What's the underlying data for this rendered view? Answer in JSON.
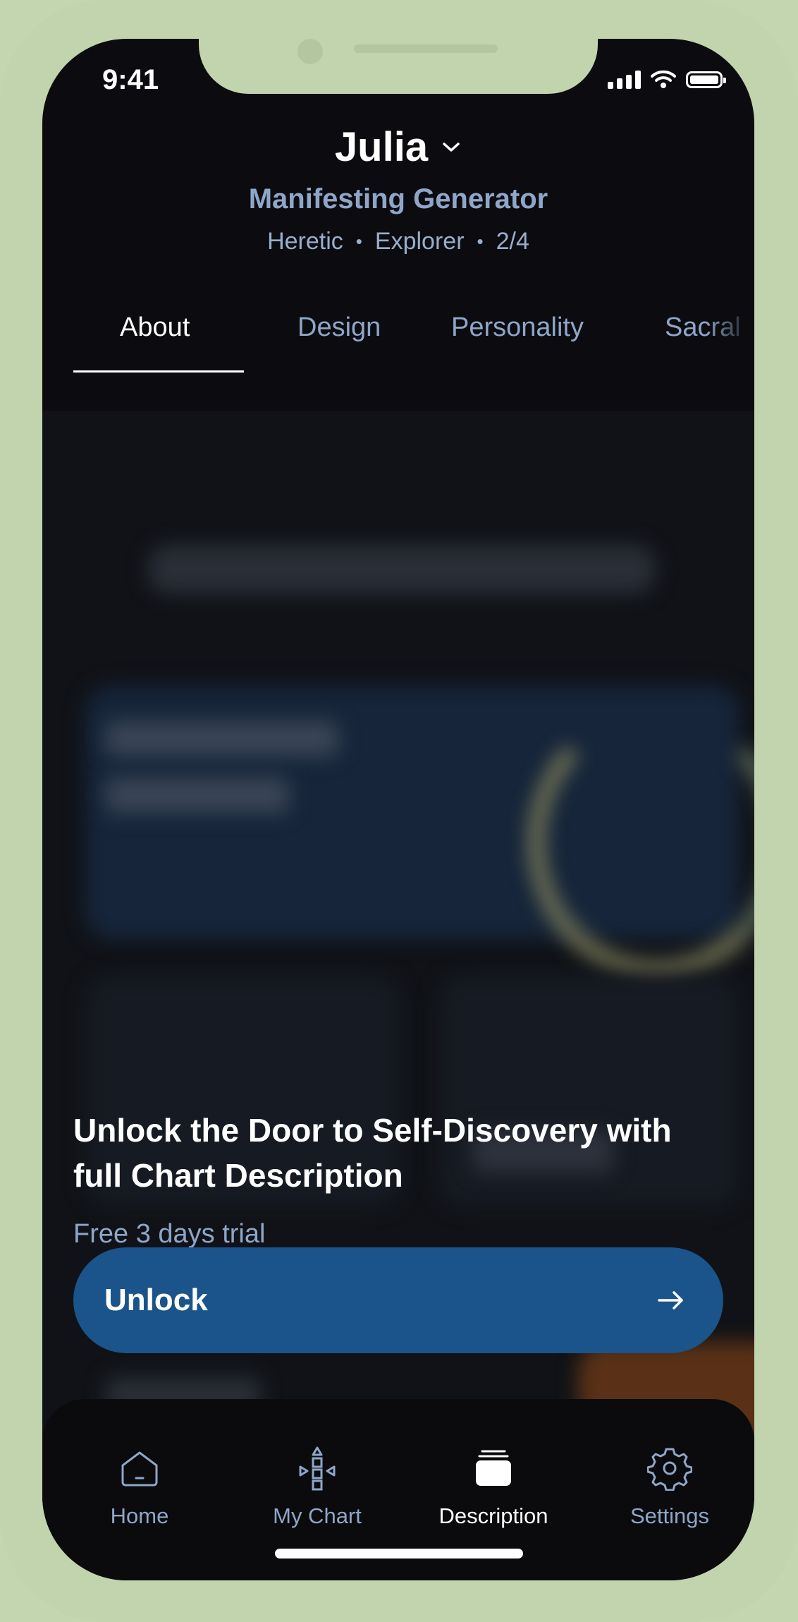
{
  "status_bar": {
    "time": "9:41"
  },
  "profile": {
    "name": "Julia",
    "type": "Manifesting Generator",
    "meta": [
      "Heretic",
      "Explorer",
      "2/4"
    ]
  },
  "tabs": [
    "About",
    "Design",
    "Personality",
    "Sacral"
  ],
  "active_tab": "About",
  "promo": {
    "title": "Unlock the Door to Self-Discovery with full Chart Description",
    "subtitle": "Free 3 days trial",
    "button_label": "Unlock"
  },
  "nav": [
    {
      "label": "Home",
      "icon": "home-icon"
    },
    {
      "label": "My Chart",
      "icon": "chart-icon"
    },
    {
      "label": "Description",
      "icon": "description-icon"
    },
    {
      "label": "Settings",
      "icon": "gear-icon"
    }
  ],
  "active_nav": "Description",
  "colors": {
    "background": "#0c0c10",
    "accent": "#1a548a",
    "muted_text": "#8ea6c8",
    "frame": "#c2d4ad"
  }
}
